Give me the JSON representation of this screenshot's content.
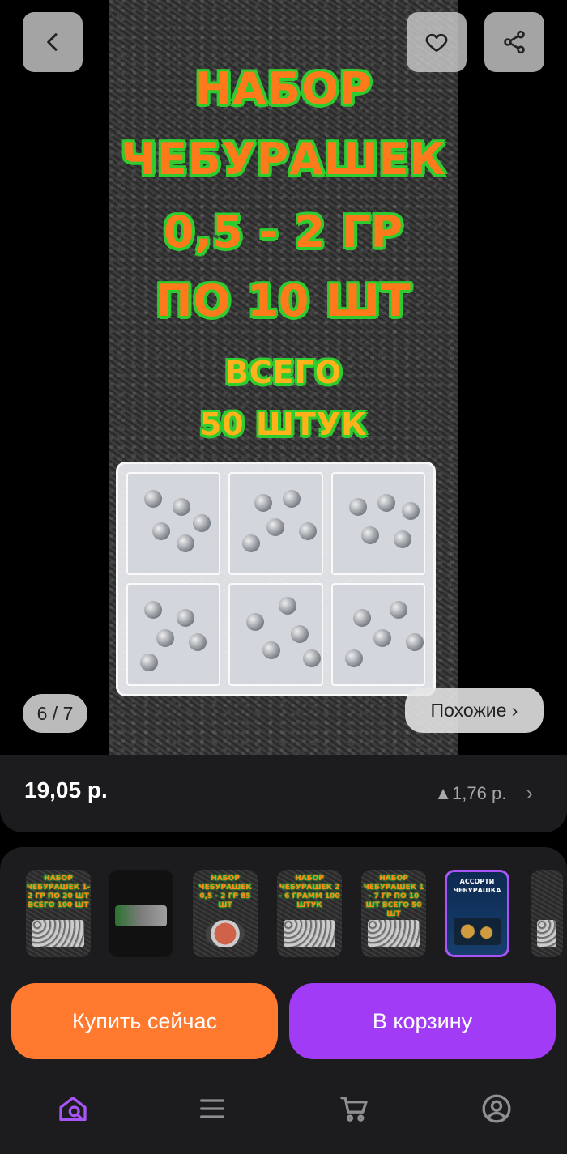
{
  "product_image": {
    "promo_lines": [
      "НАБОР",
      "ЧЕБУРАШЕК",
      "0,5 - 2 ГР",
      "ПО 10 ШТ",
      "ВСЕГО",
      "50 ШТУК"
    ],
    "counter": "6 / 7",
    "similar_label": "Похожие ›"
  },
  "header": {
    "back_icon": "chevron-left-icon",
    "favorite_icon": "heart-icon",
    "share_icon": "share-icon"
  },
  "pricing": {
    "price": "19,05 р.",
    "change": "▲1,76 р.",
    "chevron": "›"
  },
  "variants": [
    {
      "caption": "НАБОР ЧЕБУРАШЕК 1-2 ГР ПО 20 ШТ ВСЕГО 100 ШТ"
    },
    {
      "caption": ""
    },
    {
      "caption": "НАБОР ЧЕБУРАШЕК 0,5 - 2 ГР 85 ШТ"
    },
    {
      "caption": "НАБОР ЧЕБУРАШЕК 2 - 6 ГРАММ 100 ШТУК"
    },
    {
      "caption": "НАБОР ЧЕБУРАШЕК 1 - 7 ГР ПО 10 ШТ ВСЕГО 50 ШТ"
    },
    {
      "caption": "АССОРТИ ЧЕБУРАШКА"
    },
    {
      "caption": ""
    }
  ],
  "actions": {
    "buy_now": "Купить сейчас",
    "add_to_cart": "В корзину"
  },
  "nav": {
    "items": [
      "home-search-icon",
      "catalog-menu-icon",
      "cart-icon",
      "profile-icon"
    ]
  },
  "colors": {
    "buy_now": "#ff7a2f",
    "add_to_cart": "#a13bf5",
    "active_nav": "#a855f7"
  }
}
